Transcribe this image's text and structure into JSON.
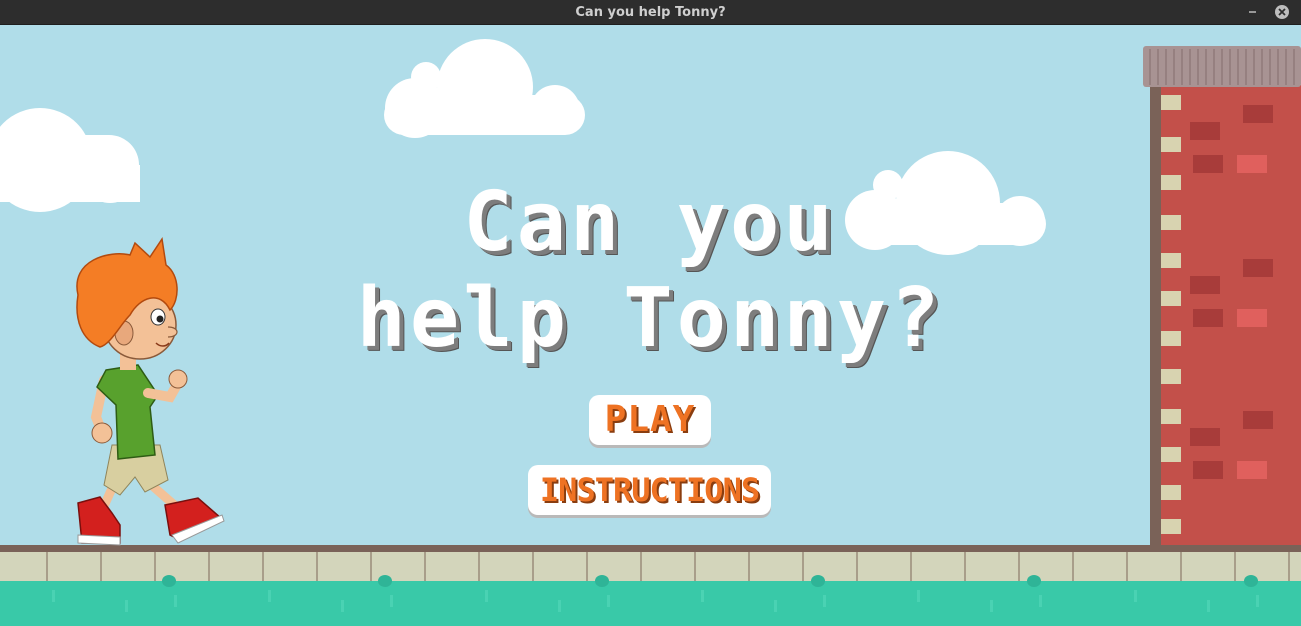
{
  "window": {
    "title": "Can you help Tonny?",
    "minimize_icon": "minimize-icon",
    "close_icon": "close-icon"
  },
  "game": {
    "title_line1": "Can you",
    "title_line2": "help Tonny?",
    "play_label": "PLAY",
    "instructions_label": "INSTRUCTIONS"
  },
  "colors": {
    "sky": "#b0dde9",
    "button_text": "#ee7223",
    "brick": "#c3504a",
    "water": "#39c9a8"
  }
}
